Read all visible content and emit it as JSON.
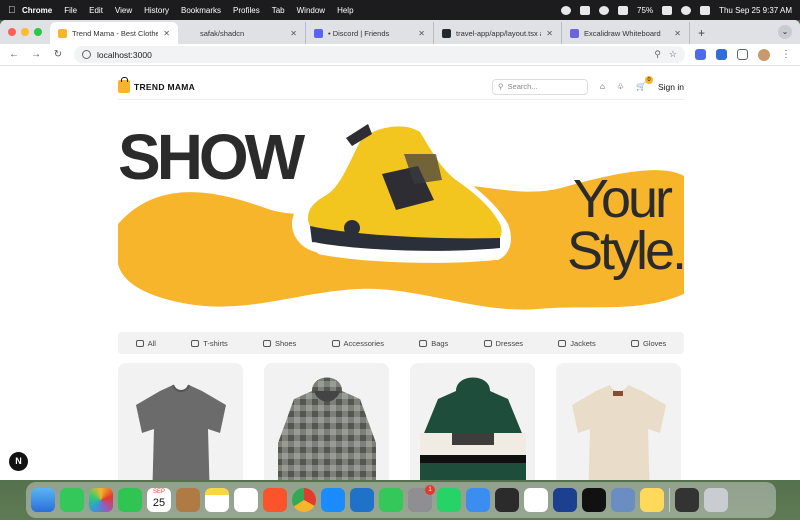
{
  "menubar": {
    "app": "Chrome",
    "menus": [
      "File",
      "Edit",
      "View",
      "History",
      "Bookmarks",
      "Profiles",
      "Tab",
      "Window",
      "Help"
    ],
    "battery": "75%",
    "datetime": "Thu Sep 25  9:37 AM"
  },
  "browser": {
    "tabs": [
      {
        "label": "Trend Mama - Best Clothes",
        "favicon_color": "#f7b52c",
        "active": true
      },
      {
        "label": "safak/shadcn",
        "favicon_color": "#dfe1e5",
        "active": false
      },
      {
        "label": "• Discord | Friends",
        "favicon_color": "#5865f2",
        "active": false
      },
      {
        "label": "travel-app/app/layout.tsx at m",
        "favicon_color": "#24292f",
        "active": false
      },
      {
        "label": "Excalidraw Whiteboard",
        "favicon_color": "#6965db",
        "active": false
      }
    ],
    "new_tab": "+",
    "url": "localhost:3000"
  },
  "site": {
    "brand": "TREND MAMA",
    "search_placeholder": "Search...",
    "cart_count": "0",
    "signin": "Sign in",
    "hero": {
      "word1": "SHOW",
      "word2": "Your",
      "word3": "Style."
    },
    "categories": [
      "All",
      "T-shirts",
      "Shoes",
      "Accessories",
      "Bags",
      "Dresses",
      "Jackets",
      "Gloves"
    ],
    "accent": "#f7b52c"
  },
  "overlay_badge": "N",
  "dock": {
    "calendar_month": "SEP",
    "calendar_day": "25",
    "settings_badge": "1",
    "apps": [
      "finder",
      "messages",
      "photos",
      "facetime",
      "calendar",
      "contacts",
      "notes",
      "freeform",
      "brave",
      "chrome",
      "app-store",
      "vscode",
      "numbers",
      "system-settings",
      "whatsapp",
      "mail",
      "davinci",
      "chatgpt",
      "preview",
      "xppen",
      "image-viewer",
      "tips",
      "screenshot",
      "trash"
    ]
  }
}
